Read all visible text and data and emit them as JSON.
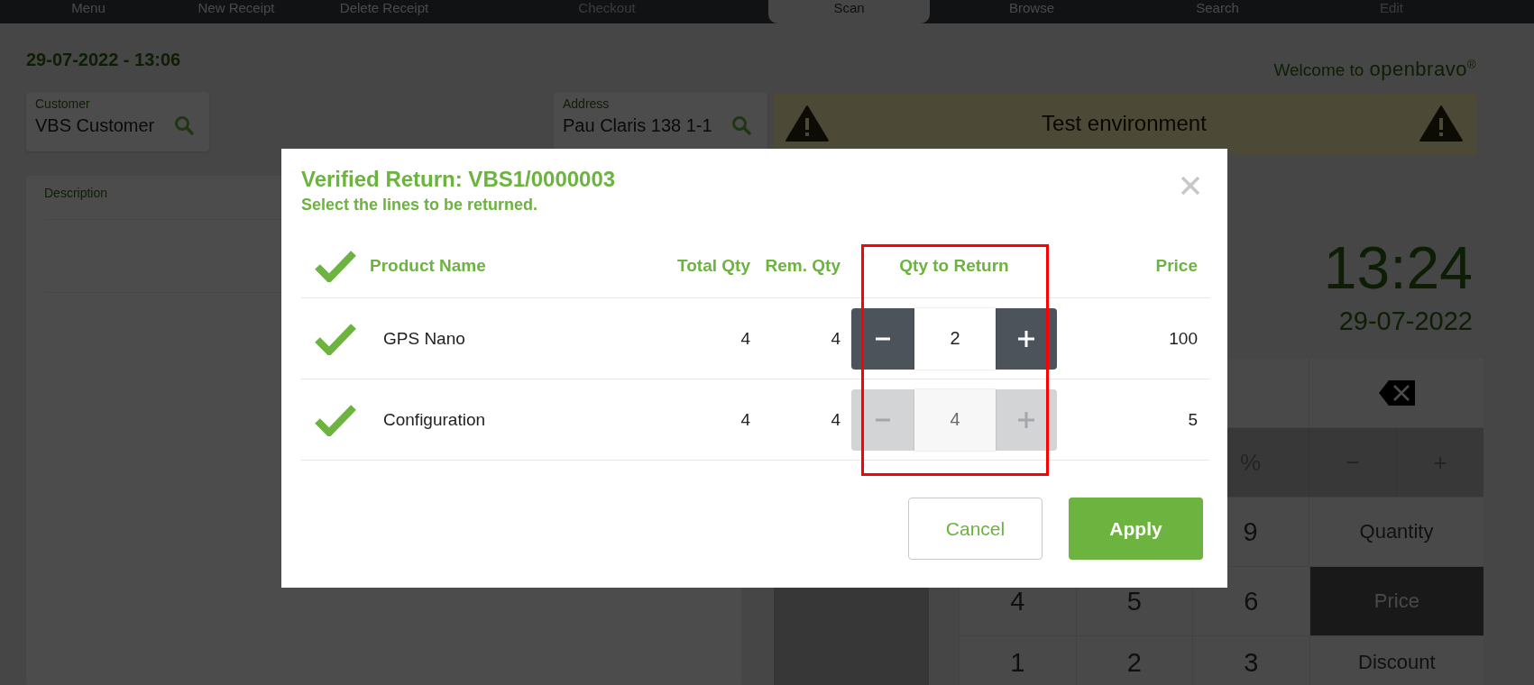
{
  "nav_tabs": [
    {
      "label": "Menu",
      "selected": false,
      "disabled": false
    },
    {
      "label": "New Receipt",
      "selected": false,
      "disabled": false
    },
    {
      "label": "Delete Receipt",
      "selected": false,
      "disabled": false
    },
    {
      "label": "Checkout",
      "selected": false,
      "disabled": true
    },
    {
      "label": "Scan",
      "selected": true,
      "disabled": false
    },
    {
      "label": "Browse",
      "selected": false,
      "disabled": false
    },
    {
      "label": "Search",
      "selected": false,
      "disabled": false
    },
    {
      "label": "Edit",
      "selected": false,
      "disabled": true
    }
  ],
  "header": {
    "datetime": "29-07-2022 - 13:06",
    "welcome": "Welcome to",
    "logo": "openbravo$^{®}$"
  },
  "customer": {
    "label": "Customer",
    "value": "VBS Customer"
  },
  "address": {
    "label": "Address",
    "value": "Pau Claris 138 1-1"
  },
  "banner": {
    "text": "Test environment"
  },
  "description": {
    "label": "Description"
  },
  "clock": {
    "time": "13:24",
    "date": "29-07-2022"
  },
  "keypad": {
    "rows": [
      {
        "keys": [
          {
            "kind": "backspace"
          }
        ]
      },
      {
        "keys": [
          {
            "kind": "percent",
            "label": "%"
          },
          {
            "kind": "sign",
            "label": "−"
          },
          {
            "kind": "sign",
            "label": "+"
          }
        ]
      },
      {
        "keys": [
          {
            "kind": "digit",
            "label": "9"
          },
          {
            "kind": "function",
            "label": "Quantity",
            "selected": false
          }
        ]
      },
      {
        "keys": [
          {
            "kind": "digit",
            "label": "4"
          },
          {
            "kind": "digit",
            "label": "5"
          },
          {
            "kind": "digit",
            "label": "6"
          },
          {
            "kind": "function",
            "label": "Price",
            "selected": true
          }
        ]
      },
      {
        "keys": [
          {
            "kind": "digit",
            "label": "1"
          },
          {
            "kind": "digit",
            "label": "2"
          },
          {
            "kind": "digit",
            "label": "3"
          },
          {
            "kind": "function",
            "label": "Discount",
            "selected": false
          }
        ]
      }
    ]
  },
  "dialog": {
    "title": "Verified Return: VBS1/0000003",
    "subtitle": "Select the lines to be returned.",
    "all_checked": true,
    "columns": [
      "Product Name",
      "Total Qty",
      "Rem. Qty",
      "Qty to Return",
      "Price"
    ],
    "rows": [
      {
        "checked": true,
        "product": "GPS Nano",
        "total_qty": "4",
        "rem_qty": "4",
        "qty_to_return": "2",
        "stepper_disabled": false,
        "price": "100"
      },
      {
        "checked": true,
        "product": "Configuration",
        "total_qty": "4",
        "rem_qty": "4",
        "qty_to_return": "4",
        "stepper_disabled": true,
        "price": "5"
      }
    ],
    "buttons": [
      {
        "label": "Cancel",
        "kind": "secondary"
      },
      {
        "label": "Apply",
        "kind": "primary"
      }
    ]
  }
}
